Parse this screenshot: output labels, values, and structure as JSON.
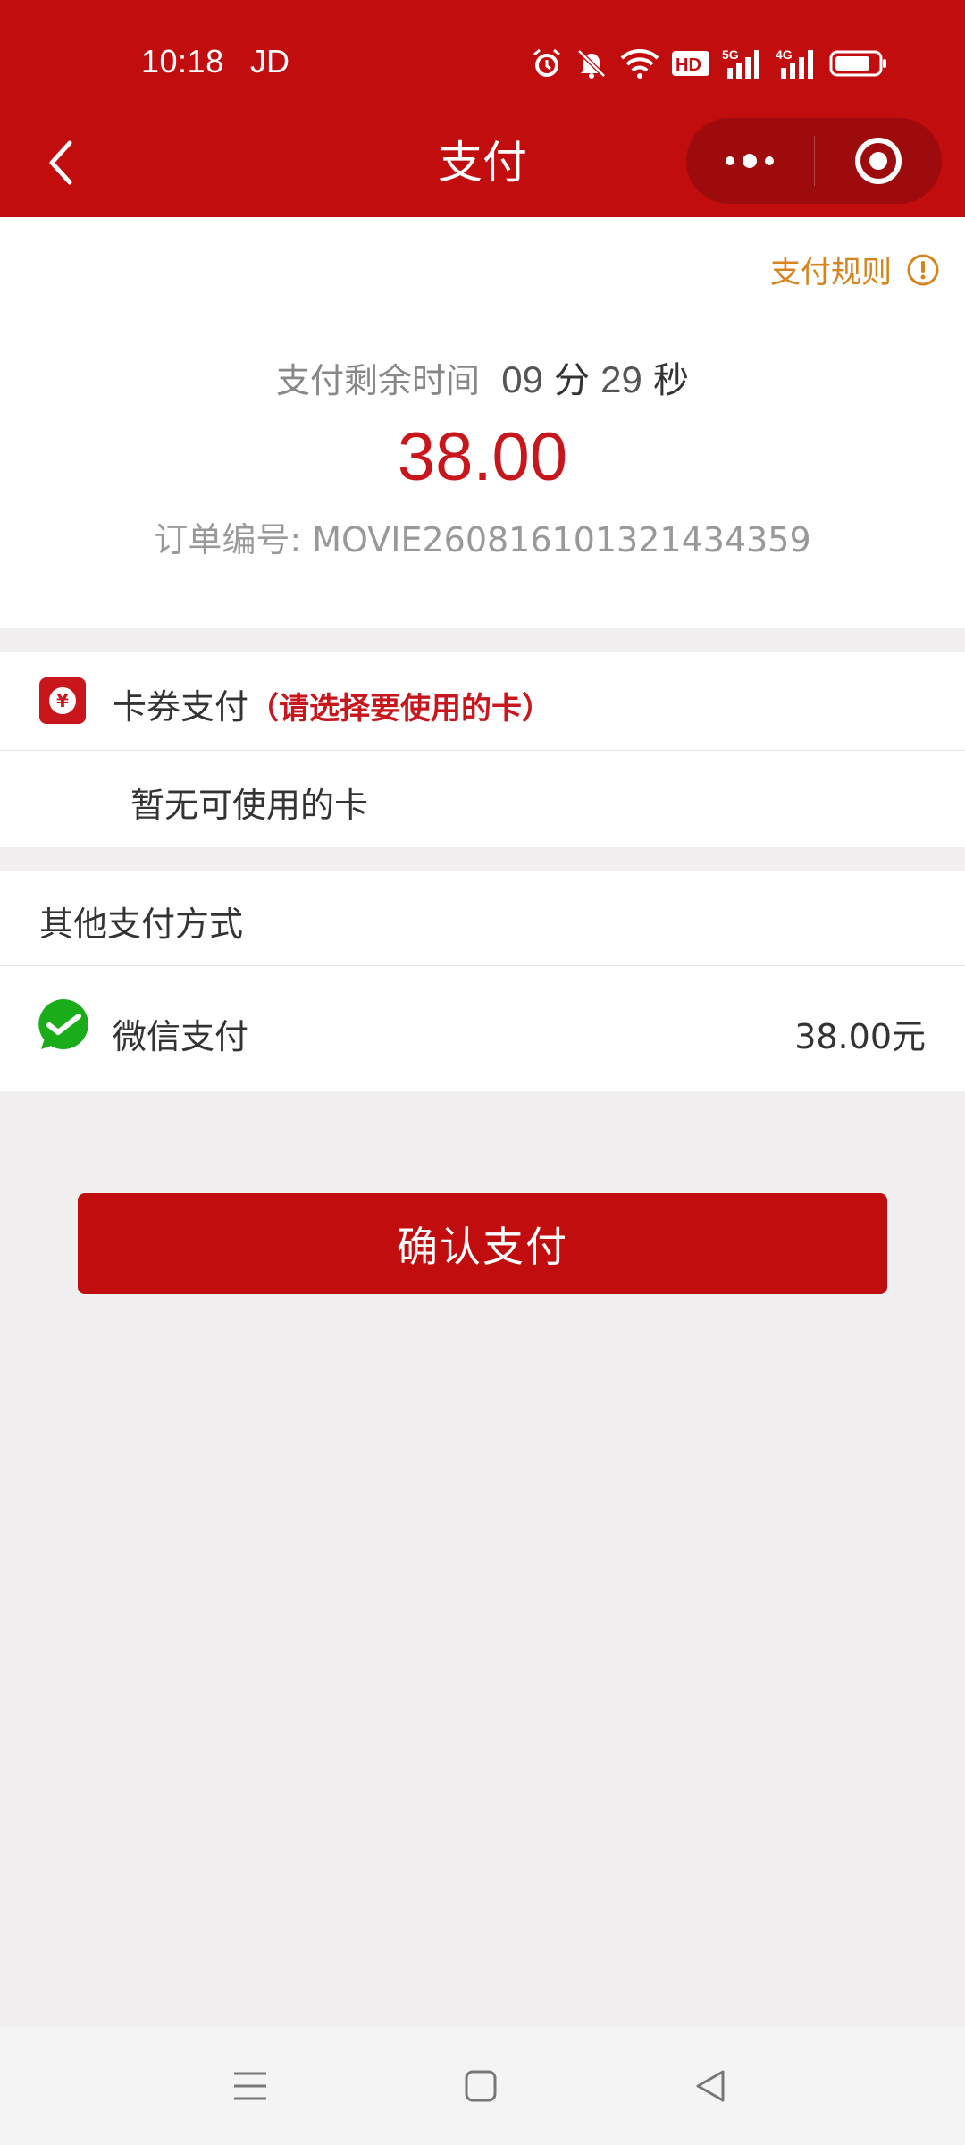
{
  "status_bar": {
    "time": "10:18",
    "carrier": "JD",
    "icons": [
      "alarm-icon",
      "bell-off-icon",
      "wifi-icon",
      "hd-icon",
      "signal-5g-icon",
      "signal-4g-icon",
      "battery-icon"
    ]
  },
  "title_bar": {
    "title": "支付",
    "back_icon": "chevron-left-icon",
    "more_icon": "more-dots-icon",
    "close_icon": "target-icon"
  },
  "order": {
    "rules_label": "支付规则",
    "countdown_label": "支付剩余时间",
    "minutes": "09",
    "minutes_unit": "分",
    "seconds": "29",
    "seconds_unit": "秒",
    "amount": "38.00",
    "order_number": "订单编号: MOVIE260816101321434359"
  },
  "card_payment": {
    "label": "卡券支付",
    "hint": "（请选择要使用的卡）",
    "empty_text": "暂无可使用的卡"
  },
  "other_payment": {
    "section_title": "其他支付方式",
    "method_label": "微信支付",
    "method_amount": "38.00元"
  },
  "confirm_button": "确认支付",
  "colors": {
    "brand_red": "#c20d0f",
    "price_red": "#c8161d",
    "rules_orange": "#d6841f",
    "wechat_green": "#1aad19"
  }
}
